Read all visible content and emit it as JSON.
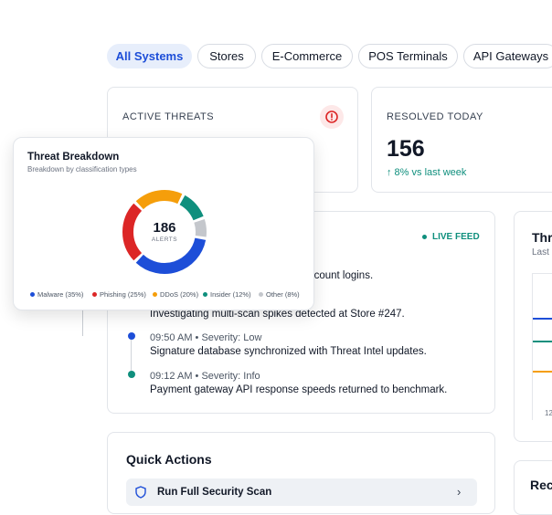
{
  "filters": [
    {
      "label": "All Systems",
      "active": true
    },
    {
      "label": "Stores",
      "active": false
    },
    {
      "label": "E-Commerce",
      "active": false
    },
    {
      "label": "POS Terminals",
      "active": false
    },
    {
      "label": "API Gateways",
      "active": false
    }
  ],
  "active_threats": {
    "label": "ACTIVE THREATS",
    "icon": "alert-circle-icon"
  },
  "resolved_today": {
    "label": "RESOLVED TODAY",
    "value": "156",
    "trend": "↑ 8% vs last week"
  },
  "live_feed": {
    "badge": "LIVE FEED",
    "partial_line": "er account logins.",
    "partial_line2": "Investigating multi-scan spikes detected at Store #247.",
    "items": [
      {
        "time": "09:50 AM • Severity: Low",
        "message": "Signature database synchronized with Threat Intel updates.",
        "color": "#1d4ed8"
      },
      {
        "time": "09:12 AM • Severity: Info",
        "message": "Payment gateway API response speeds returned to benchmark.",
        "color": "#0f8f7d"
      }
    ]
  },
  "right_card": {
    "title": "Thr",
    "subtitle": "Last",
    "tick": "12"
  },
  "quick_actions": {
    "title": "Quick Actions",
    "first_action": "Run Full Security Scan"
  },
  "recent_card": {
    "title": "Rec"
  },
  "breakdown": {
    "title": "Threat Breakdown",
    "subtitle": "Breakdown by classification types",
    "total": "186",
    "total_label": "ALERTS",
    "segments": [
      {
        "name": "Malware",
        "pct": 35,
        "label": "Malware (35%)",
        "color": "#1d4ed8"
      },
      {
        "name": "Phishing",
        "pct": 25,
        "label": "Phishing (25%)",
        "color": "#dc2626"
      },
      {
        "name": "DDoS",
        "pct": 20,
        "label": "DDoS (20%)",
        "color": "#f59e0b"
      },
      {
        "name": "Insider",
        "pct": 12,
        "label": "Insider (12%)",
        "color": "#0f8f7d"
      },
      {
        "name": "Other",
        "pct": 8,
        "label": "Other (8%)",
        "color": "#c4c7cc"
      }
    ]
  }
}
